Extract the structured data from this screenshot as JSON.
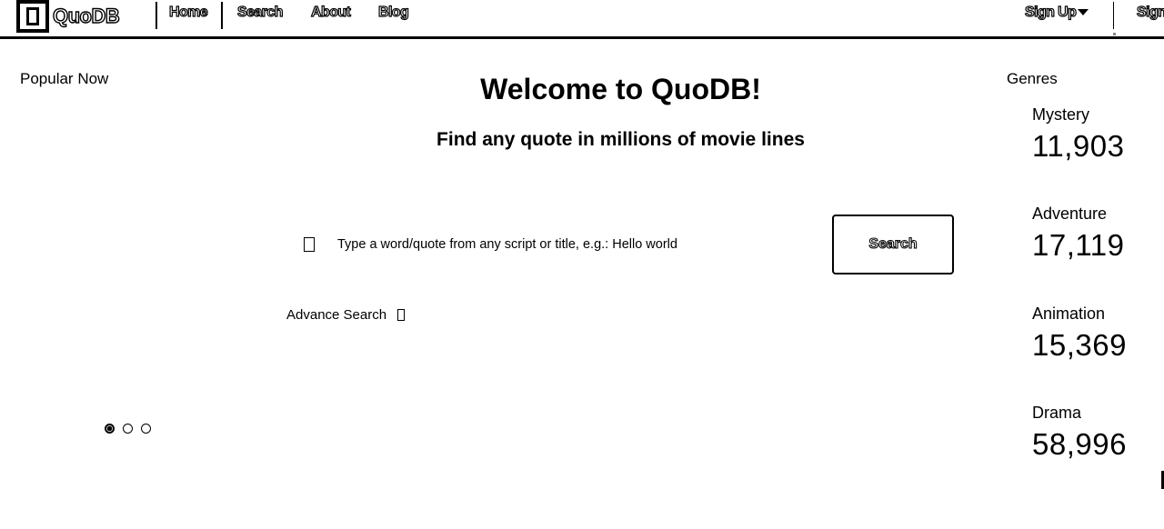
{
  "nav": {
    "logo_text": "QuoDB",
    "links": [
      "Home",
      "Search",
      "About",
      "Blog"
    ],
    "sign_up": "Sign Up",
    "sign_in_partial": "Sign"
  },
  "sidebar_left": {
    "label": "Popular Now",
    "dots": 3,
    "active_dot": 0
  },
  "main": {
    "title": "Welcome to QuoDB!",
    "subtitle": "Find any quote in millions of movie lines",
    "search_placeholder": "Type a word/quote from any script or title, e.g.: Hello world",
    "search_button": "Search",
    "advance_search": "Advance Search"
  },
  "sidebar_right": {
    "label": "Genres",
    "genres": [
      {
        "name": "Mystery",
        "count": "11,903"
      },
      {
        "name": "Adventure",
        "count": "17,119"
      },
      {
        "name": "Animation",
        "count": "15,369"
      },
      {
        "name": "Drama",
        "count": "58,996"
      }
    ]
  }
}
